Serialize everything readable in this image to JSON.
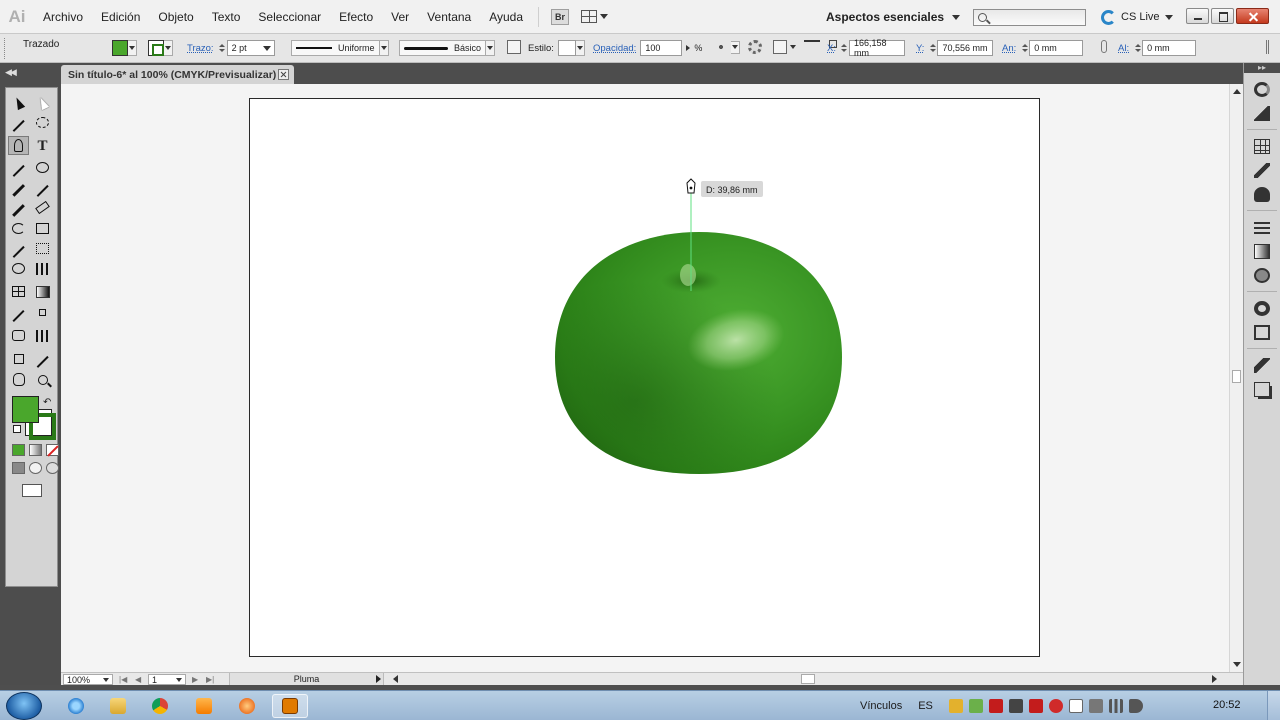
{
  "app": {
    "logo": "Ai",
    "menu": [
      "Archivo",
      "Edición",
      "Objeto",
      "Texto",
      "Seleccionar",
      "Efecto",
      "Ver",
      "Ventana",
      "Ayuda"
    ],
    "bridge_label": "Br",
    "workspace": "Aspectos esenciales",
    "search_placeholder": "",
    "cs_live": "CS Live"
  },
  "control_bar": {
    "object_type": "Trazado",
    "stroke_label": "Trazo:",
    "stroke_weight": "2 pt",
    "profile_label": "Uniforme",
    "brush_label": "Básico",
    "style_label": "Estilo:",
    "opacity_label": "Opacidad:",
    "opacity_value": "100",
    "opacity_unit": "%",
    "x_label": "X:",
    "x_value": "166,158 mm",
    "y_label": "Y:",
    "y_value": "70,556 mm",
    "width_label": "An:",
    "width_value": "0 mm",
    "height_label": "Al:",
    "height_value": "0 mm",
    "fill_color": "#4aa72c",
    "stroke_color": "#2a7a18"
  },
  "document": {
    "tab_title": "Sin título-6* al 100% (CMYK/Previsualizar)",
    "tooltip": "D: 39,86 mm"
  },
  "status_bar": {
    "zoom": "100%",
    "page": "1",
    "current_tool": "Pluma"
  },
  "taskbar": {
    "tray_label": "Vínculos",
    "language": "ES",
    "clock": "20:52"
  },
  "icons": {
    "tools": [
      "selection-tool-icon",
      "direct-selection-tool-icon",
      "magic-wand-tool-icon",
      "lasso-tool-icon",
      "pen-tool-icon",
      "type-tool-icon",
      "line-segment-tool-icon",
      "ellipse-tool-icon",
      "paintbrush-tool-icon",
      "pencil-tool-icon",
      "blob-brush-tool-icon",
      "eraser-tool-icon",
      "rotate-tool-icon",
      "scale-tool-icon",
      "width-tool-icon",
      "free-transform-tool-icon",
      "shape-builder-tool-icon",
      "perspective-grid-tool-icon",
      "mesh-tool-icon",
      "gradient-tool-icon",
      "eyedropper-tool-icon",
      "blend-tool-icon",
      "symbol-sprayer-tool-icon",
      "column-graph-tool-icon",
      "artboard-tool-icon",
      "slice-tool-icon",
      "hand-tool-icon",
      "zoom-tool-icon"
    ],
    "dock": [
      "color-panel-icon",
      "color-guide-icon",
      "swatches-icon",
      "brushes-icon",
      "symbols-icon",
      "stroke-panel-icon",
      "gradient-panel-icon",
      "transparency-icon",
      "appearance-icon",
      "graphic-styles-icon",
      "layers-icon",
      "artboards-icon"
    ]
  }
}
